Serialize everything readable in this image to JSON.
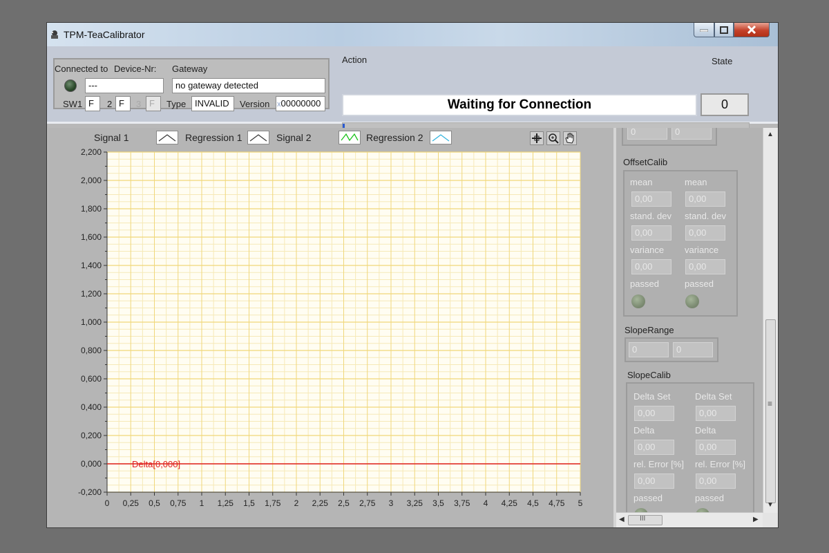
{
  "window": {
    "title": "TPM-TeaCalibrator"
  },
  "connection": {
    "connected_to_label": "Connected to",
    "device_nr_label": "Device-Nr:",
    "device_nr_value": "---",
    "gateway_label": "Gateway",
    "gateway_value": "no gateway detected",
    "sw1_label": "SW1",
    "sw1_value": "F",
    "sw2_label": "2",
    "sw2_value": "F",
    "sw3_label": "3",
    "sw3_value": "F",
    "type_label": "Type",
    "type_value": "INVALID",
    "version_label": "Version",
    "version_prefix": "x",
    "version_value": "00000000"
  },
  "action": {
    "label": "Action",
    "status": "Waiting for Connection",
    "progress": 0.005
  },
  "state": {
    "label": "State",
    "value": "0"
  },
  "graph": {
    "legend": [
      {
        "label": "Signal 1",
        "color": "#3a3a3a"
      },
      {
        "label": "Regression 1",
        "color": "#3a3a3a"
      },
      {
        "label": "Signal 2",
        "color": "#19c219"
      },
      {
        "label": "Regression 2",
        "color": "#35b4de"
      }
    ],
    "tools": [
      "cursor-icon",
      "zoom-icon",
      "pan-hand-icon"
    ],
    "cursor_label": "Delta[0,000]"
  },
  "chart_data": {
    "type": "line",
    "x_ticks": [
      "0",
      "0,25",
      "0,5",
      "0,75",
      "1",
      "1,25",
      "1,5",
      "1,75",
      "2",
      "2,25",
      "2,5",
      "2,75",
      "3",
      "3,25",
      "3,5",
      "3,75",
      "4",
      "4,25",
      "4,5",
      "4,75",
      "5"
    ],
    "y_ticks": [
      "2,200",
      "2,000",
      "1,800",
      "1,600",
      "1,400",
      "1,200",
      "1,000",
      "0,800",
      "0,600",
      "0,400",
      "0,200",
      "0,000",
      "-0,200"
    ],
    "xlim": [
      0,
      5
    ],
    "ylim": [
      -0.2,
      2.2
    ],
    "grid": true,
    "series": [
      {
        "name": "Signal 1",
        "x": [],
        "y": []
      },
      {
        "name": "Regression 1",
        "x": [],
        "y": []
      },
      {
        "name": "Signal 2",
        "x": [],
        "y": []
      },
      {
        "name": "Regression 2",
        "x": [],
        "y": []
      }
    ],
    "cursor": {
      "label": "Delta[0,000]",
      "y": 0,
      "color": "#e02020"
    },
    "plot_background": "#fffdf2",
    "grid_major_color": "#f0d77a",
    "grid_minor_color": "#f6e9b7"
  },
  "right_panel": {
    "top_fields": [
      "0",
      "0"
    ],
    "offset_calib": {
      "title": "OffsetCalib",
      "col1": {
        "mean_label": "mean",
        "mean": "0,00",
        "stdev_label": "stand. dev",
        "stdev": "0,00",
        "variance_label": "variance",
        "variance": "0,00",
        "passed_label": "passed"
      },
      "col2": {
        "mean_label": "mean",
        "mean": "0,00",
        "stdev_label": "stand. dev",
        "stdev": "0,00",
        "variance_label": "variance",
        "variance": "0,00",
        "passed_label": "passed"
      }
    },
    "slope_range": {
      "title": "SlopeRange",
      "min": "0",
      "max": "0"
    },
    "slope_calib": {
      "title": "SlopeCalib",
      "col1": {
        "delta_set_label": "Delta Set",
        "delta_set": "0,00",
        "delta_label": "Delta",
        "delta": "0,00",
        "rel_err_label": "rel. Error [%]",
        "rel_err": "0,00",
        "passed_label": "passed"
      },
      "col2": {
        "delta_set_label": "Delta Set",
        "delta_set": "0,00",
        "delta_label": "Delta",
        "delta": "0,00",
        "rel_err_label": "rel. Error [%]",
        "rel_err": "0,00",
        "passed_label": "passed"
      }
    },
    "hscroll_grip": "III",
    "vscroll_grip": "≡"
  }
}
